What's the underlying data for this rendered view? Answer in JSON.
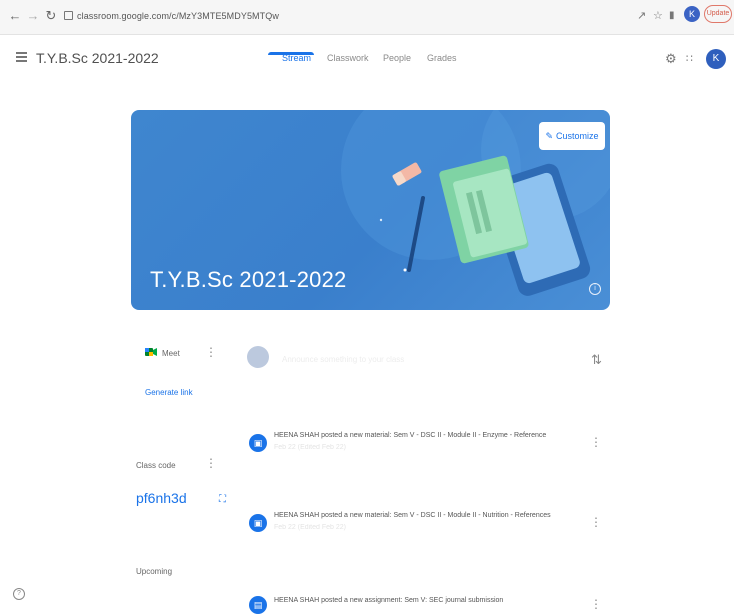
{
  "browser": {
    "url": "classroom.google.com/c/MzY3MTE5MDY5MTQw",
    "update_label": "Update",
    "profile_initial": "K"
  },
  "header": {
    "class_title": "T.Y.B.Sc 2021-2022",
    "tabs": [
      {
        "label": "Stream",
        "active": true
      },
      {
        "label": "Classwork",
        "active": false
      },
      {
        "label": "People",
        "active": false
      },
      {
        "label": "Grades",
        "active": false
      }
    ],
    "user_initial": "K"
  },
  "banner": {
    "title": "T.Y.B.Sc 2021-2022",
    "customize_label": "Customize",
    "info_glyph": "i",
    "color": "#3f86cf"
  },
  "sidebar": {
    "meet_label": "Meet",
    "generate_link_label": "Generate link",
    "class_code_label": "Class code",
    "class_code": "pf6nh3d",
    "upcoming_label": "Upcoming"
  },
  "stream": {
    "compose_placeholder": "Announce something to your class",
    "posts": [
      {
        "text": "HEENA SHAH posted a new material: Sem V - DSC II - Module II - Enzyme - Reference",
        "date": "Feb 22 (Edited Feb 22)",
        "icon": "material-icon"
      },
      {
        "text": "HEENA SHAH posted a new material: Sem V - DSC II - Module II - Nutrition - References",
        "date": "Feb 22 (Edited Feb 22)",
        "icon": "material-icon"
      },
      {
        "text": "HEENA SHAH posted a new assignment: Sem V: SEC journal submission",
        "date": "",
        "icon": "assignment-icon"
      }
    ]
  },
  "colors": {
    "accent": "#1a73e8",
    "banner": "#3f86cf"
  }
}
